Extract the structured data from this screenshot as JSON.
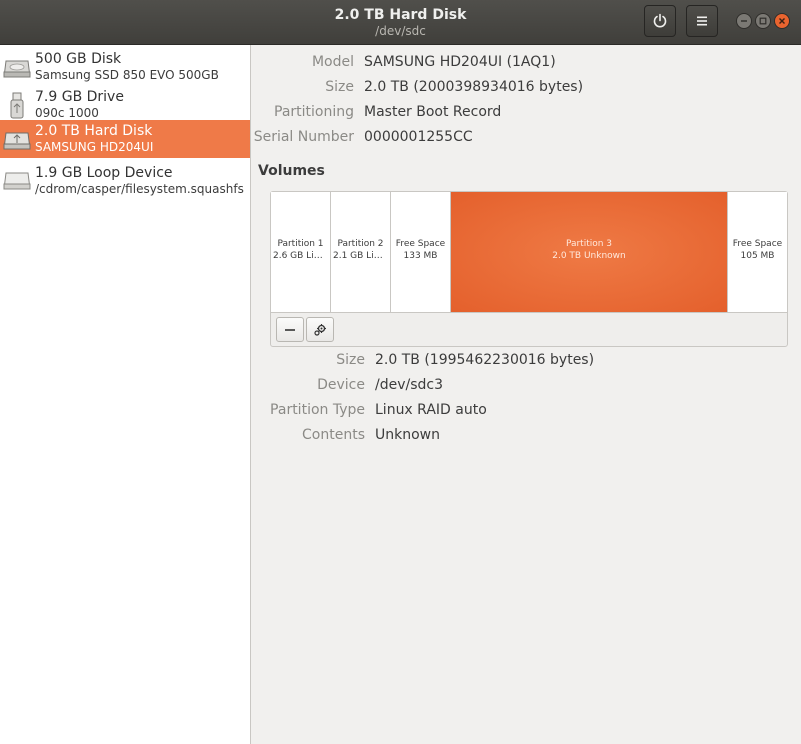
{
  "window": {
    "title": "2.0 TB Hard Disk",
    "subtitle": "/dev/sdc",
    "power_icon": "power-icon",
    "menu_icon": "hamburger-menu-icon"
  },
  "sidebar": {
    "devices": [
      {
        "name": "500 GB Disk",
        "detail": "Samsung SSD 850 EVO 500GB",
        "icon": "hard-disk-icon",
        "selected": false
      },
      {
        "name": "7.9 GB Drive",
        "detail": "090c 1000",
        "icon": "usb-drive-icon",
        "selected": false
      },
      {
        "name": "2.0 TB Hard Disk",
        "detail": "SAMSUNG HD204UI",
        "icon": "hard-disk-icon",
        "selected": true
      },
      {
        "name": "1.9 GB Loop Device",
        "detail": "/cdrom/casper/filesystem.squashfs",
        "icon": "loop-device-icon",
        "selected": false
      }
    ]
  },
  "disk": {
    "model_label": "Model",
    "model": "SAMSUNG HD204UI (1AQ1)",
    "size_label": "Size",
    "size": "2.0 TB (2000398934016 bytes)",
    "partitioning_label": "Partitioning",
    "partitioning": "Master Boot Record",
    "serial_label": "Serial Number",
    "serial": "0000001255CC"
  },
  "volumes": {
    "heading": "Volumes",
    "segments": [
      {
        "name": "Partition 1",
        "detail": "2.6 GB Lin…",
        "selected": false
      },
      {
        "name": "Partition 2",
        "detail": "2.1 GB Lin…",
        "selected": false
      },
      {
        "name": "Free Space",
        "detail": "133 MB",
        "selected": false
      },
      {
        "name": "Partition 3",
        "detail": "2.0 TB Unknown",
        "selected": true
      },
      {
        "name": "Free Space",
        "detail": "105 MB",
        "selected": false
      }
    ],
    "tools": [
      "remove-partition-icon",
      "settings-gears-icon"
    ]
  },
  "partition": {
    "size_label": "Size",
    "size": "2.0 TB (1995462230016 bytes)",
    "device_label": "Device",
    "device": "/dev/sdc3",
    "type_label": "Partition Type",
    "type": "Linux RAID auto",
    "contents_label": "Contents",
    "contents": "Unknown"
  },
  "colors": {
    "accent": "#ef7a48",
    "titlebar": "#45443f",
    "close_button": "#e9642f"
  }
}
